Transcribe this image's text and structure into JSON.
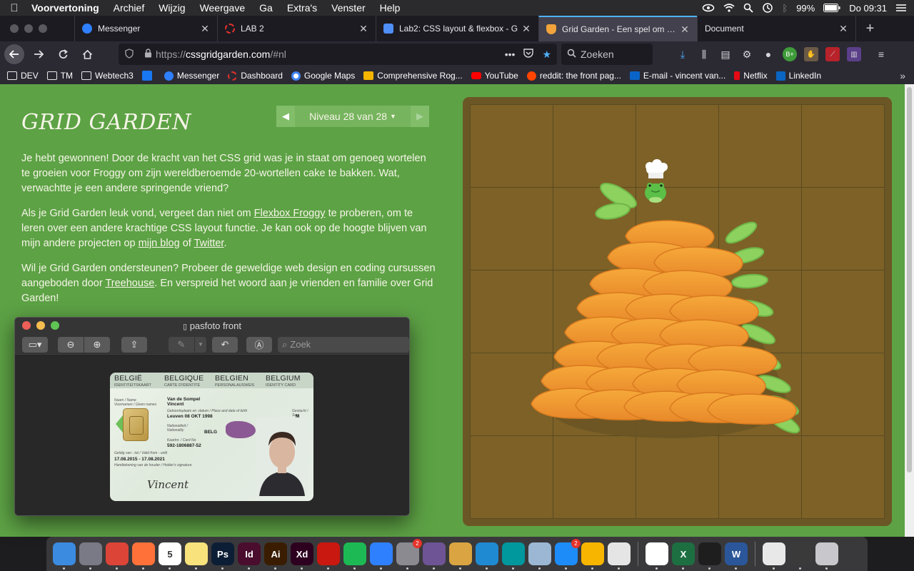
{
  "menubar": {
    "app_name": "Voorvertoning",
    "items": [
      "Archief",
      "Wijzig",
      "Weergave",
      "Ga",
      "Extra's",
      "Venster",
      "Help"
    ],
    "battery": "99%",
    "clock": "Do 09:31"
  },
  "browser": {
    "tabs": [
      {
        "label": "Messenger",
        "favicon_color": "#2f80ff",
        "active": false
      },
      {
        "label": "LAB 2",
        "favicon_color": "#e0312c",
        "active": false
      },
      {
        "label": "Lab2: CSS layout & flexbox - G",
        "favicon_color": "#4f8ef7",
        "active": false
      },
      {
        "label": "Grid Garden - Een spel om CSS",
        "favicon_color": "#f2a33b",
        "active": true
      },
      {
        "label": "Document",
        "favicon_color": "#1c1b22",
        "active": false
      }
    ],
    "url": {
      "scheme": "https://",
      "host": "cssgridgarden.com",
      "path": "/#nl"
    },
    "search_placeholder": "Zoeken",
    "bookmarks": [
      {
        "label": "DEV",
        "icon": "folder-icon"
      },
      {
        "label": "TM",
        "icon": "folder-icon"
      },
      {
        "label": "Webtech3",
        "icon": "folder-icon"
      },
      {
        "label": "",
        "icon": "facebook-icon",
        "color": "#1877f2"
      },
      {
        "label": "Messenger",
        "icon": "messenger-icon",
        "color": "#2f80ff"
      },
      {
        "label": "Dashboard",
        "icon": "dashboard-icon",
        "color": "#e0312c"
      },
      {
        "label": "Google Maps",
        "icon": "google-icon",
        "color": "#ffffff"
      },
      {
        "label": "Comprehensive Rog...",
        "icon": "bookmark-icon",
        "color": "#f5b400"
      },
      {
        "label": "YouTube",
        "icon": "youtube-icon",
        "color": "#ff0000"
      },
      {
        "label": "reddit: the front pag...",
        "icon": "reddit-icon",
        "color": "#ff4500"
      },
      {
        "label": "E-mail - vincent van...",
        "icon": "outlook-icon",
        "color": "#0a64c8"
      },
      {
        "label": "Netflix",
        "icon": "netflix-icon",
        "color": "#e50914"
      },
      {
        "label": "LinkedIn",
        "icon": "linkedin-icon",
        "color": "#0a66c2"
      }
    ]
  },
  "page": {
    "title": "GRID GARDEN",
    "level": "Niveau 28 van 28",
    "p1": "Je hebt gewonnen! Door de kracht van het CSS grid was je in staat om genoeg wortelen te groeien voor Froggy om zijn wereldberoemde 20-wortellen cake te bakken. Wat, verwachtte je een andere springende vriend?",
    "p2": {
      "a": "Als je Grid Garden leuk vond, vergeet dan niet om ",
      "link1": "Flexbox Froggy",
      "b": " te proberen, om te leren over een andere krachtige CSS layout functie. Je kan ook op de hoogte blijven van mijn andere projecten op ",
      "link2": "mijn blog",
      "c": " of ",
      "link3": "Twitter",
      "d": "."
    },
    "p3": {
      "a": "Wil je Grid Garden ondersteunen? Probeer de geweldige web design en coding cursussen aangeboden door ",
      "link": "Treehouse",
      "b": ". En verspreid het woord aan je vrienden en familie over Grid Garden!"
    }
  },
  "preview": {
    "title": "pasfoto front",
    "search_placeholder": "Zoek",
    "card": {
      "countries": [
        "BELGIË",
        "BELGIQUE",
        "BELGIEN",
        "BELGIUM"
      ],
      "subtitles": [
        "IDENTITEITSKAART",
        "CARTE D'IDENTITÉ",
        "PERSONALAUSWEIS",
        "IDENTITY CARD"
      ],
      "name_label": "Naam / Name",
      "name": "Van de Sompel",
      "given_label": "Voornamen / Given names",
      "given": "Vincent",
      "birth_label": "Geboorteplaats en -datum / Place and date of birth",
      "birth": "Leuven  08 OKT  1998",
      "sex_label": "Geslacht / Sex",
      "sex": "M",
      "nat_label": "Nationaliteit / Nationality",
      "nat": "BELG",
      "cardno_label": "Kaartnr. / Card No",
      "cardno": "592-1806887-52",
      "valid_label": "Geldig van - tot / Valid from - until",
      "valid": "17.08.2015 - 17.08.2021",
      "holder_label": "Handtekening van de houder / Holder's signature",
      "signature": "Vincent"
    }
  },
  "dock": {
    "apps": [
      {
        "name": "finder-icon",
        "color": "#3b8be0",
        "label": ""
      },
      {
        "name": "launchpad-icon",
        "color": "#7a7a86",
        "label": ""
      },
      {
        "name": "chrome-icon",
        "color": "#db4437",
        "label": ""
      },
      {
        "name": "firefox-icon",
        "color": "#ff7139",
        "label": ""
      },
      {
        "name": "calendar-icon",
        "color": "#ffffff",
        "label": "5"
      },
      {
        "name": "notes-icon",
        "color": "#f7e27c",
        "label": ""
      },
      {
        "name": "photoshop-icon",
        "color": "#0c1e35",
        "label": "Ps"
      },
      {
        "name": "indesign-icon",
        "color": "#4a0d2e",
        "label": "Id"
      },
      {
        "name": "illustrator-icon",
        "color": "#3a1d00",
        "label": "Ai"
      },
      {
        "name": "xd-icon",
        "color": "#2e001f",
        "label": "Xd"
      },
      {
        "name": "acrobat-icon",
        "color": "#c8180f",
        "label": ""
      },
      {
        "name": "spotify-icon",
        "color": "#1db954",
        "label": ""
      },
      {
        "name": "messenger-icon",
        "color": "#2f80ff",
        "label": ""
      },
      {
        "name": "system-preferences-icon",
        "color": "#8a8a90",
        "label": "",
        "badge": "2"
      },
      {
        "name": "github-icon",
        "color": "#6e5494",
        "label": ""
      },
      {
        "name": "sequel-icon",
        "color": "#d9a441",
        "label": ""
      },
      {
        "name": "vscode-icon",
        "color": "#1f8ad2",
        "label": ""
      },
      {
        "name": "arduino-icon",
        "color": "#00979d",
        "label": ""
      },
      {
        "name": "preview-icon",
        "color": "#9bb7d4",
        "label": ""
      },
      {
        "name": "app-store-icon",
        "color": "#1d8cf8",
        "label": "",
        "badge": "2"
      },
      {
        "name": "sketch-icon",
        "color": "#f7b500",
        "label": ""
      },
      {
        "name": "tableplus-icon",
        "color": "#e5e5e5",
        "label": ""
      },
      {
        "name": "slack-icon",
        "color": "#ffffff",
        "label": ""
      },
      {
        "name": "excel-icon",
        "color": "#1d6f42",
        "label": "X"
      },
      {
        "name": "terminal-icon",
        "color": "#1e1e1e",
        "label": ""
      },
      {
        "name": "word-icon",
        "color": "#2b579a",
        "label": "W"
      }
    ],
    "trailing": [
      {
        "name": "document-icon",
        "color": "#e8e8e8",
        "label": ""
      },
      {
        "name": "screenshot-icon",
        "color": "#3a3a3a",
        "label": ""
      },
      {
        "name": "trash-icon",
        "color": "#c8c8cc",
        "label": ""
      }
    ]
  }
}
